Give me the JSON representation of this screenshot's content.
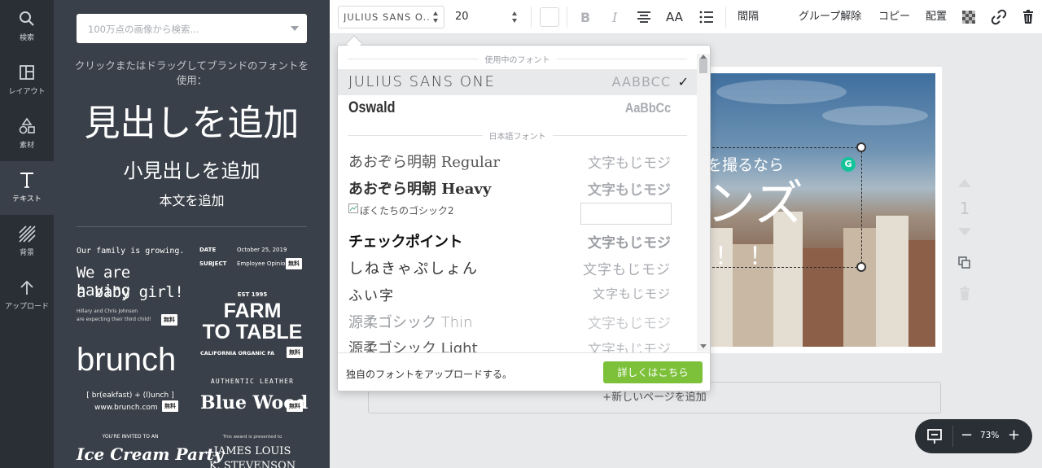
{
  "rail": {
    "items": [
      {
        "label": "検索",
        "icon": "search-icon"
      },
      {
        "label": "レイアウト",
        "icon": "layout-icon"
      },
      {
        "label": "素材",
        "icon": "elements-icon"
      },
      {
        "label": "テキスト",
        "icon": "text-icon"
      },
      {
        "label": "背景",
        "icon": "background-icon"
      },
      {
        "label": "アップロード",
        "icon": "upload-icon"
      }
    ]
  },
  "panel": {
    "search_placeholder": "100万点の画像から検索...",
    "hint": "クリックまたはドラッグしてブランドのフォントを使用：",
    "heading": "見出しを追加",
    "subheading": "小見出しを追加",
    "body": "本文を追加",
    "badge_free": "無料",
    "templates": {
      "family_line1": "Our family is growing.",
      "family_line2": "We are having",
      "family_line3": "a baby girl!",
      "family_line4": "Hillary and Chris Johnson",
      "family_line5": "are expecting their third child!",
      "memo_date_label": "DATE",
      "memo_date_value": "October 25, 2019",
      "memo_subject_label": "SUBJECT",
      "memo_subject_value": "Employee Opinion",
      "farm_est": "EST 1995",
      "farm_line1": "FARM",
      "farm_line2": "TO TABLE",
      "farm_sub": "CALIFORNIA ORGANIC FA",
      "brunch_title": "brunch",
      "brunch_def": "[ br(eakfast) + (l)unch ]",
      "brunch_url": "www.brunch.com",
      "leather_top": "AUTHENTIC LEATHER",
      "leather_main": "Blue Wood",
      "icecream_top": "YOU'RE INVITED TO AN",
      "icecream_main": "Ice Cream Party",
      "award_top": "This award is presented to",
      "award_line1": "JAMES LOUIS",
      "award_line2": "K. STEVENSON"
    }
  },
  "toolbar": {
    "font_value": "JULIUS SANS O...",
    "size_value": "20",
    "spacing": "間隔",
    "ungroup": "グループ解除",
    "copy": "コピー",
    "arrange": "配置",
    "text_case": "AA"
  },
  "dropdown": {
    "section_in_use": "使用中のフォント",
    "section_japanese": "日本語フォント",
    "fonts_in_use": [
      {
        "name": "JULIUS SANS ONE",
        "sample": "AABBCC",
        "selected": true
      },
      {
        "name": "Oswald",
        "sample": "AaBbCc",
        "selected": false
      }
    ],
    "japanese_fonts": [
      {
        "name": "あおぞら明朝 Regular",
        "sample": "文字もじモジ"
      },
      {
        "name": "あおぞら明朝 Heavy",
        "sample": "文字もじモジ"
      },
      {
        "name": "ぼくたちのゴシック2",
        "sample": ""
      },
      {
        "name": "チェックポイント",
        "sample": "文字もじモジ"
      },
      {
        "name": "しねきゃぷしょん",
        "sample": "文字もじモジ"
      },
      {
        "name": "ふい字",
        "sample": "文字もじモジ"
      },
      {
        "name": "源柔ゴシック Thin",
        "sample": "文字もじモジ"
      },
      {
        "name": "源柔ゴシック Light",
        "sample": "文字もじモジ"
      }
    ],
    "check": "✓",
    "footer_text": "独自のフォントをアップロードする。",
    "footer_button": "詳しくはこちら"
  },
  "canvas": {
    "text_line1": "を撮るなら",
    "text_line2": "ンズ",
    "text_line3": "！！",
    "grammarly": "G",
    "page_number": "1",
    "add_page": "+新しいページを追加"
  },
  "zoom": {
    "minus": "−",
    "value": "73%",
    "plus": "+"
  },
  "colors": {
    "rail_bg": "#2a2f36",
    "panel_bg": "#3a4049",
    "accent_green": "#7dc13a",
    "grammarly": "#15c39a"
  }
}
